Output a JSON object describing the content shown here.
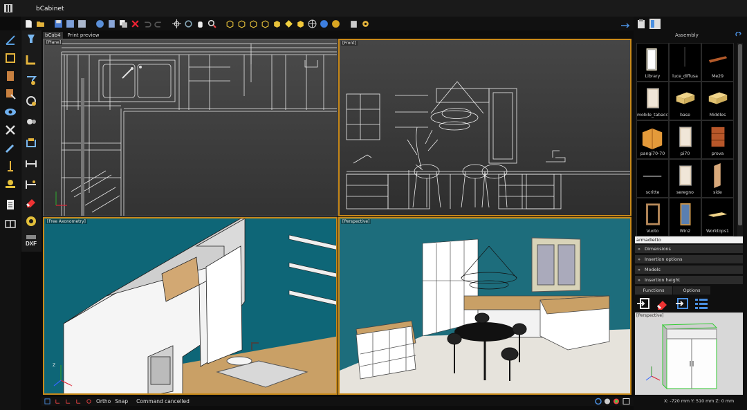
{
  "app": {
    "title": "bCabinet"
  },
  "doc_tabs": [
    {
      "label": "bCab4",
      "active": true
    },
    {
      "label": "Print preview",
      "active": false
    }
  ],
  "viewports": {
    "plane": "[Plane]",
    "front": "[Front]",
    "axonometry": "[Free Axonometry]",
    "perspective": "[Perspective]"
  },
  "statusbar": {
    "ortho": "Ortho",
    "snap": "Snap",
    "message": "Command cancelled"
  },
  "assembly": {
    "title": "Assembly",
    "items": [
      {
        "label": "Library",
        "icon": "library-icon"
      },
      {
        "label": "luce_diffusa",
        "icon": "light-icon"
      },
      {
        "label": "Me29",
        "icon": "shelf-icon"
      },
      {
        "label": "mobile_tabacchi",
        "icon": "cabinet-icon"
      },
      {
        "label": "base",
        "icon": "base-icon"
      },
      {
        "label": "Middles",
        "icon": "middles-icon"
      },
      {
        "label": "pangi70-70",
        "icon": "corner-cabinet-icon"
      },
      {
        "label": "pi70",
        "icon": "cabinet-icon"
      },
      {
        "label": "prova",
        "icon": "drawers-icon"
      },
      {
        "label": "scritte",
        "icon": "text-icon"
      },
      {
        "label": "seregno",
        "icon": "cabinet-icon"
      },
      {
        "label": "side",
        "icon": "side-panel-icon"
      },
      {
        "label": "Vuoto",
        "icon": "empty-frame-icon"
      },
      {
        "label": "Win2",
        "icon": "window-icon"
      },
      {
        "label": "Worktops1",
        "icon": "worktop-icon"
      }
    ]
  },
  "search": {
    "value": "armadietto"
  },
  "accordion": [
    "Dimensions",
    "Insertion options",
    "Models",
    "Insertion height"
  ],
  "tabs": {
    "functions": "Functions",
    "options": "Options"
  },
  "preview": {
    "label": "[Perspective]"
  },
  "coords": "X: -720 mm Y: 510 mm Z: 0 mm",
  "axes": {
    "x": "X",
    "y": "Y",
    "z": "Z"
  },
  "colors": {
    "accent": "#c98a1a",
    "viewport_bg": "#1d6d7c",
    "wood": "#c9a066"
  }
}
